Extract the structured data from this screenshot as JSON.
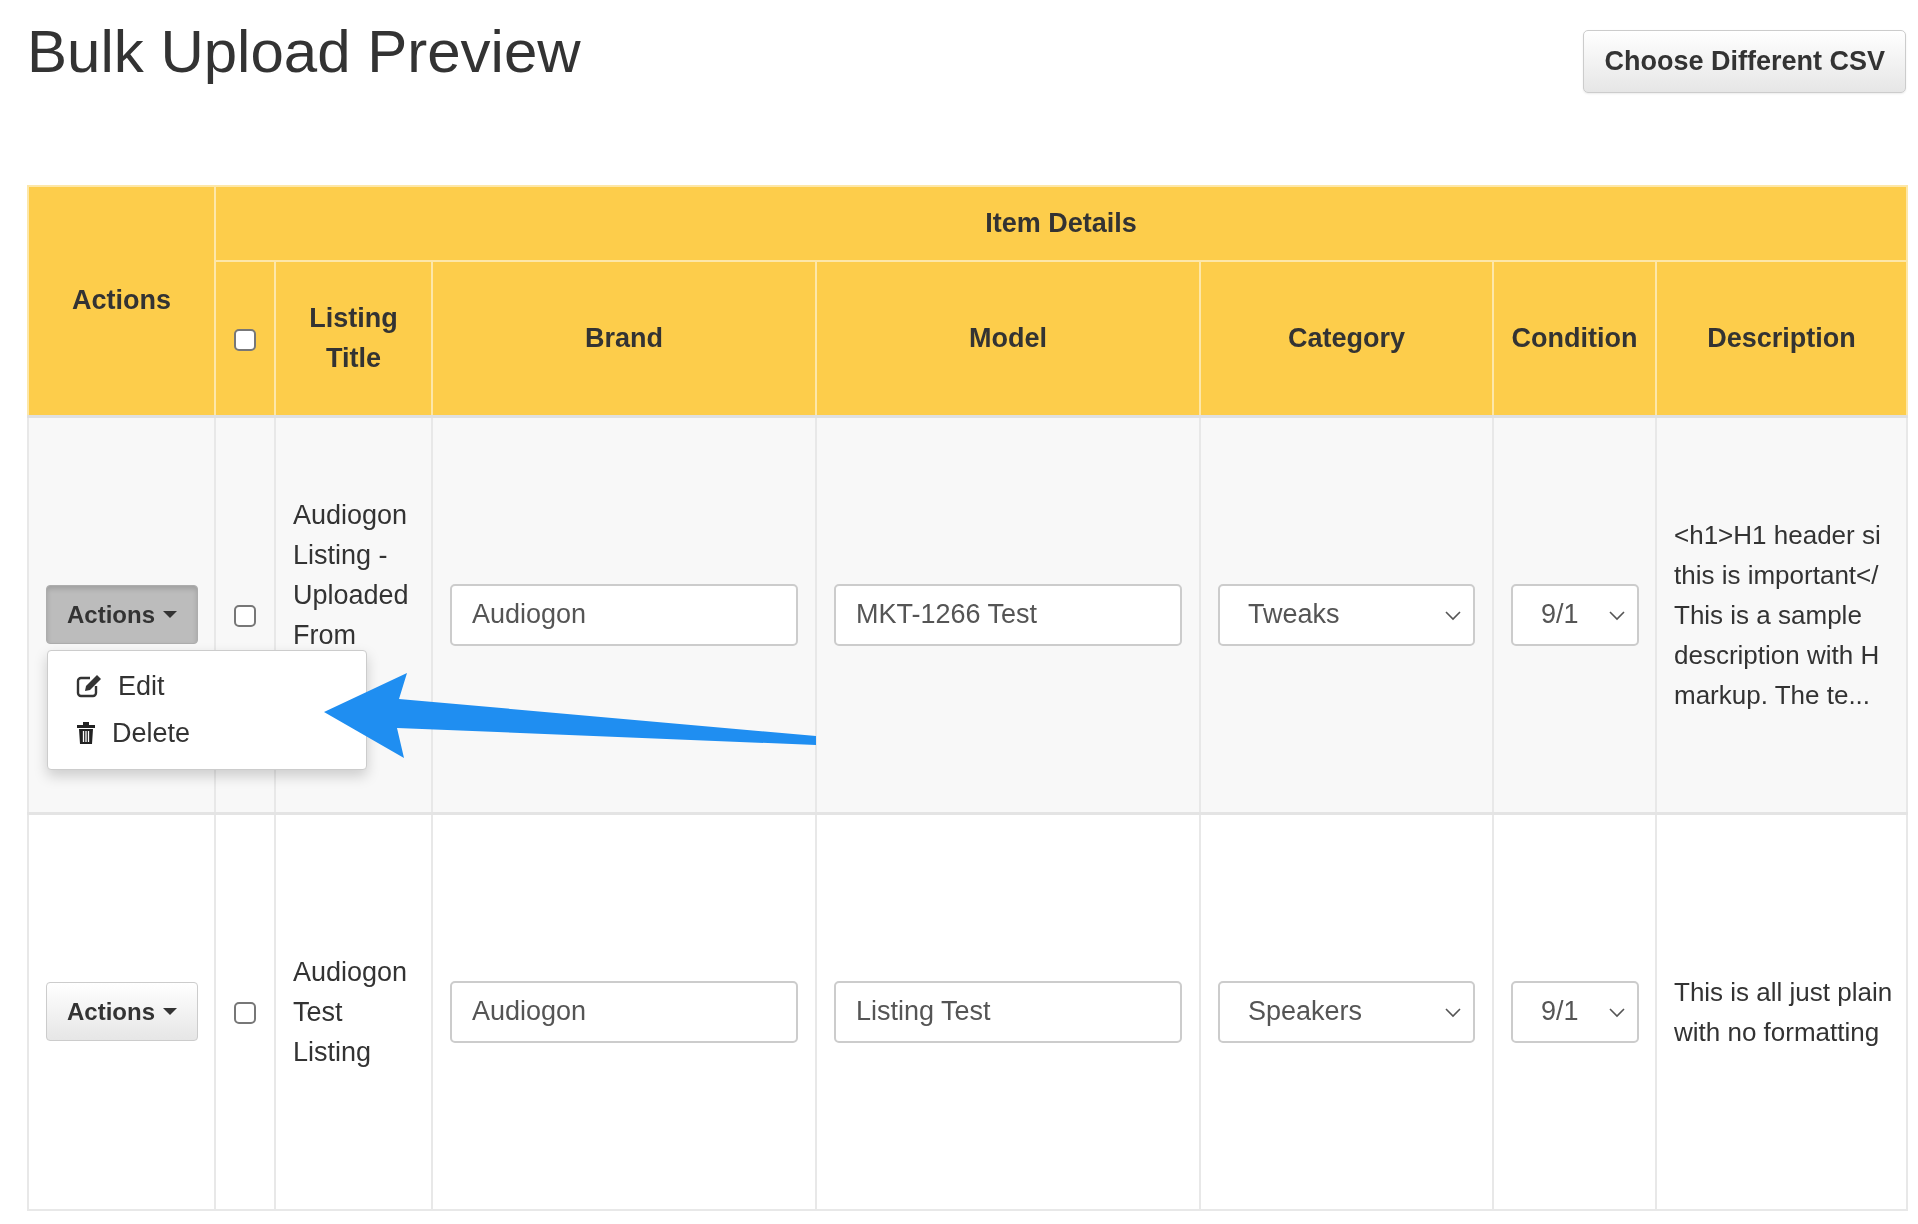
{
  "title": "Bulk Upload Preview",
  "choose_button": "Choose Different CSV",
  "table": {
    "actions_header": "Actions",
    "group_header": "Item Details",
    "select_all_checked": false,
    "columns": [
      "Listing Title",
      "Brand",
      "Model",
      "Category",
      "Condition",
      "Description"
    ],
    "rows": [
      {
        "actions_label": "Actions",
        "expanded": true,
        "checked": false,
        "title": "Audiogon Listing - Uploaded From",
        "brand": "Audiogon",
        "model": "MKT-1266 Test",
        "category": "Tweaks",
        "condition": "9/1",
        "description_lines": [
          "<h1>H1 header si",
          "this is important</",
          "This is a sample",
          "description with H",
          "markup. The te..."
        ]
      },
      {
        "actions_label": "Actions",
        "expanded": false,
        "checked": false,
        "title": "Audiogon Test Listing",
        "brand": "Audiogon",
        "model": "Listing Test",
        "category": "Speakers",
        "condition": "9/1",
        "description_lines": [
          "This is all just plain",
          "with no formatting"
        ]
      }
    ]
  },
  "menu": {
    "items": [
      {
        "kind": "edit",
        "label": "Edit"
      },
      {
        "kind": "delete",
        "label": "Delete"
      }
    ]
  }
}
